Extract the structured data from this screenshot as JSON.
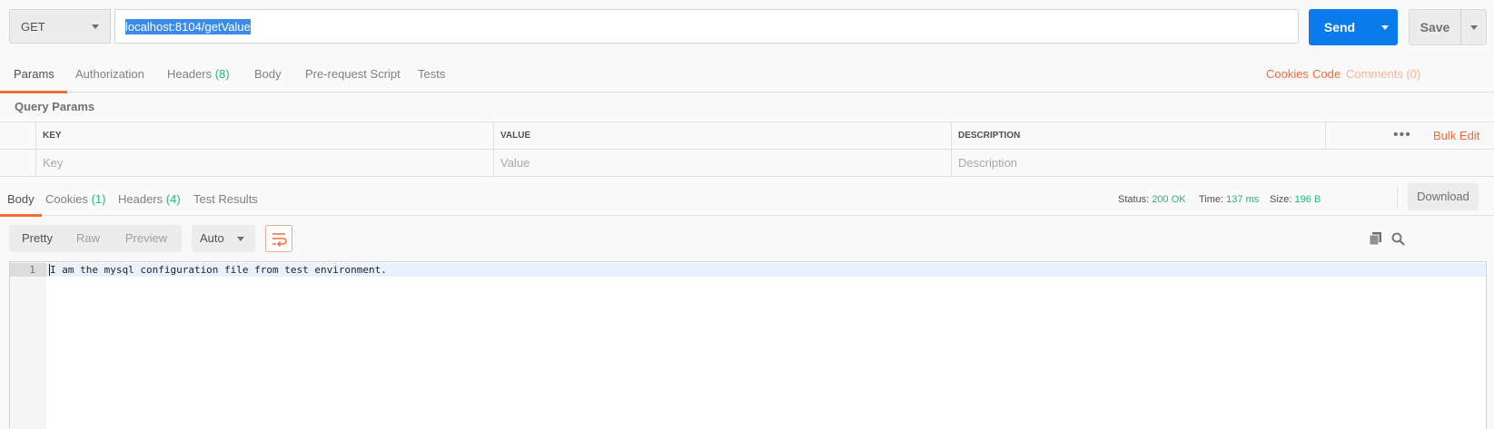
{
  "request": {
    "method": "GET",
    "url": "localhost:8104/getValue",
    "send_label": "Send",
    "save_label": "Save"
  },
  "request_tabs": {
    "params": "Params",
    "authorization": "Authorization",
    "headers": "Headers",
    "headers_count": "(8)",
    "body": "Body",
    "prerequest": "Pre-request Script",
    "tests": "Tests",
    "cookies_link": "Cookies",
    "code_link": "Code",
    "comments_link": "Comments (0)"
  },
  "query_params": {
    "title": "Query Params",
    "columns": {
      "key": "KEY",
      "value": "VALUE",
      "description": "DESCRIPTION"
    },
    "placeholders": {
      "key": "Key",
      "value": "Value",
      "description": "Description"
    },
    "more_icon": "•••",
    "bulk_edit": "Bulk Edit"
  },
  "response_tabs": {
    "body": "Body",
    "cookies": "Cookies",
    "cookies_count": "(1)",
    "headers": "Headers",
    "headers_count": "(4)",
    "test_results": "Test Results"
  },
  "response_meta": {
    "status_label": "Status:",
    "status_value": "200 OK",
    "time_label": "Time:",
    "time_value": "137 ms",
    "size_label": "Size:",
    "size_value": "196 B",
    "download_label": "Download"
  },
  "body_toolbar": {
    "pretty": "Pretty",
    "raw": "Raw",
    "preview": "Preview",
    "format": "Auto"
  },
  "editor": {
    "line_number": "1",
    "line_text": "I am the mysql configuration file from test environment."
  },
  "colors": {
    "accent": "#f26b3a",
    "send_blue": "#097bed",
    "success_green": "#26b47f"
  }
}
